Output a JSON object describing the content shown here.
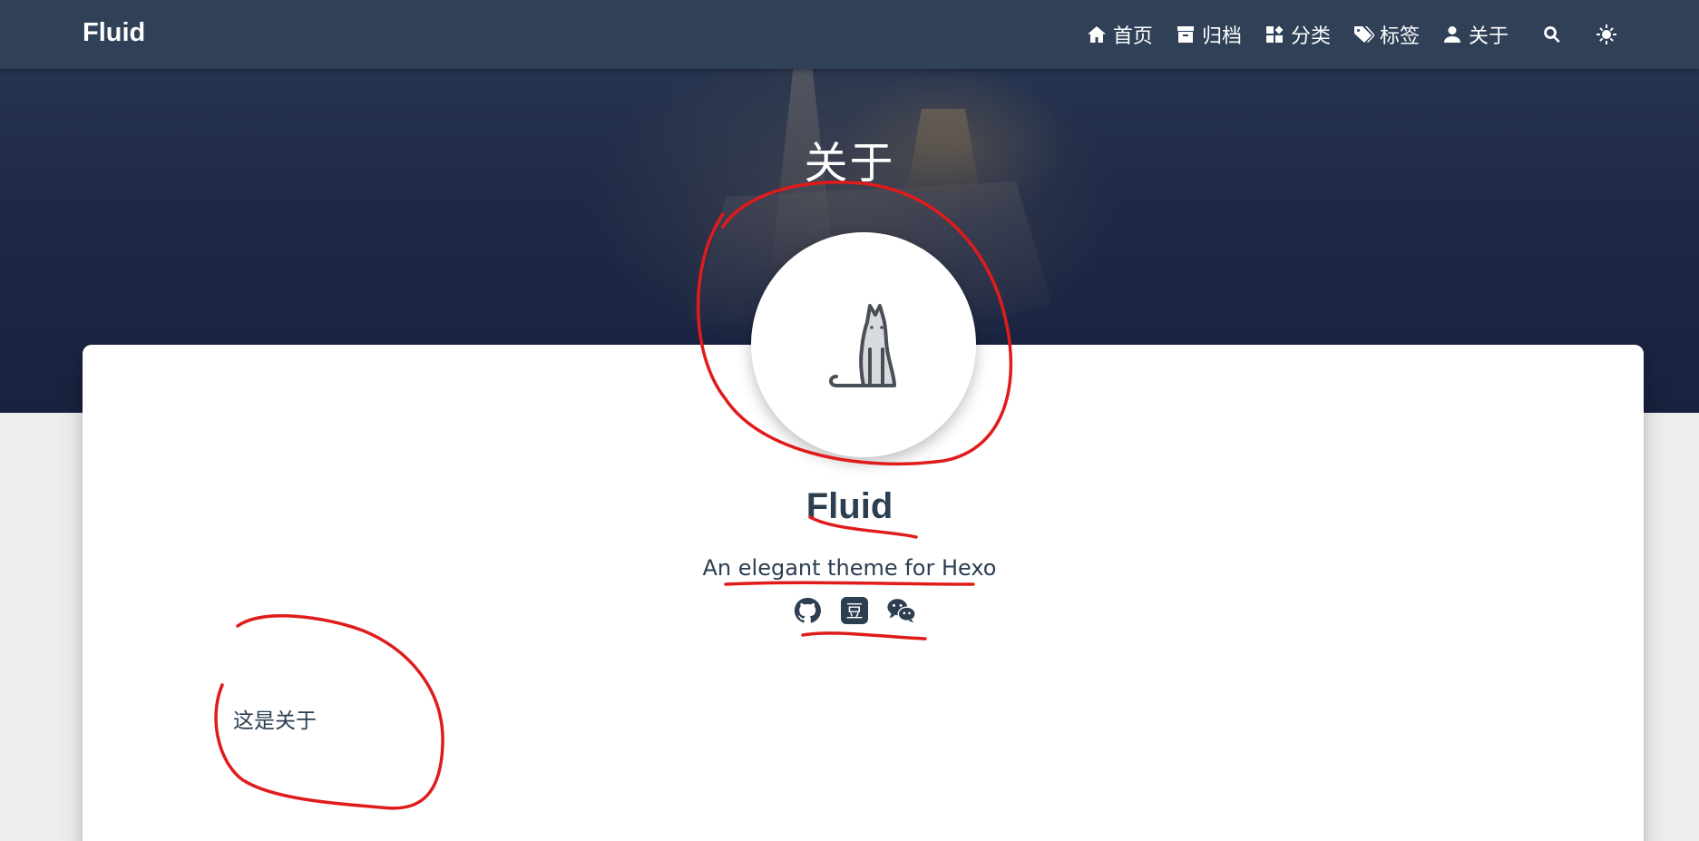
{
  "navbar": {
    "brand": "Fluid",
    "items": [
      {
        "label": "首页",
        "icon": "home-icon"
      },
      {
        "label": "归档",
        "icon": "archive-icon"
      },
      {
        "label": "分类",
        "icon": "category-icon"
      },
      {
        "label": "标签",
        "icon": "tags-icon"
      },
      {
        "label": "关于",
        "icon": "user-icon"
      }
    ],
    "search_icon": "search-icon",
    "theme_icon": "sun-icon"
  },
  "banner": {
    "title": "关于"
  },
  "about": {
    "avatar_icon": "cat-icon",
    "name": "Fluid",
    "intro": "An elegant theme for Hexo",
    "social_icons": [
      "github-icon",
      "douban-icon",
      "wechat-icon"
    ],
    "douban_glyph": "豆"
  },
  "content": {
    "text": "这是关于"
  },
  "colors": {
    "navbar": "#304158",
    "banner_dark": "#19213e",
    "text": "#2c3e50",
    "annotation": "#e01b1b"
  }
}
